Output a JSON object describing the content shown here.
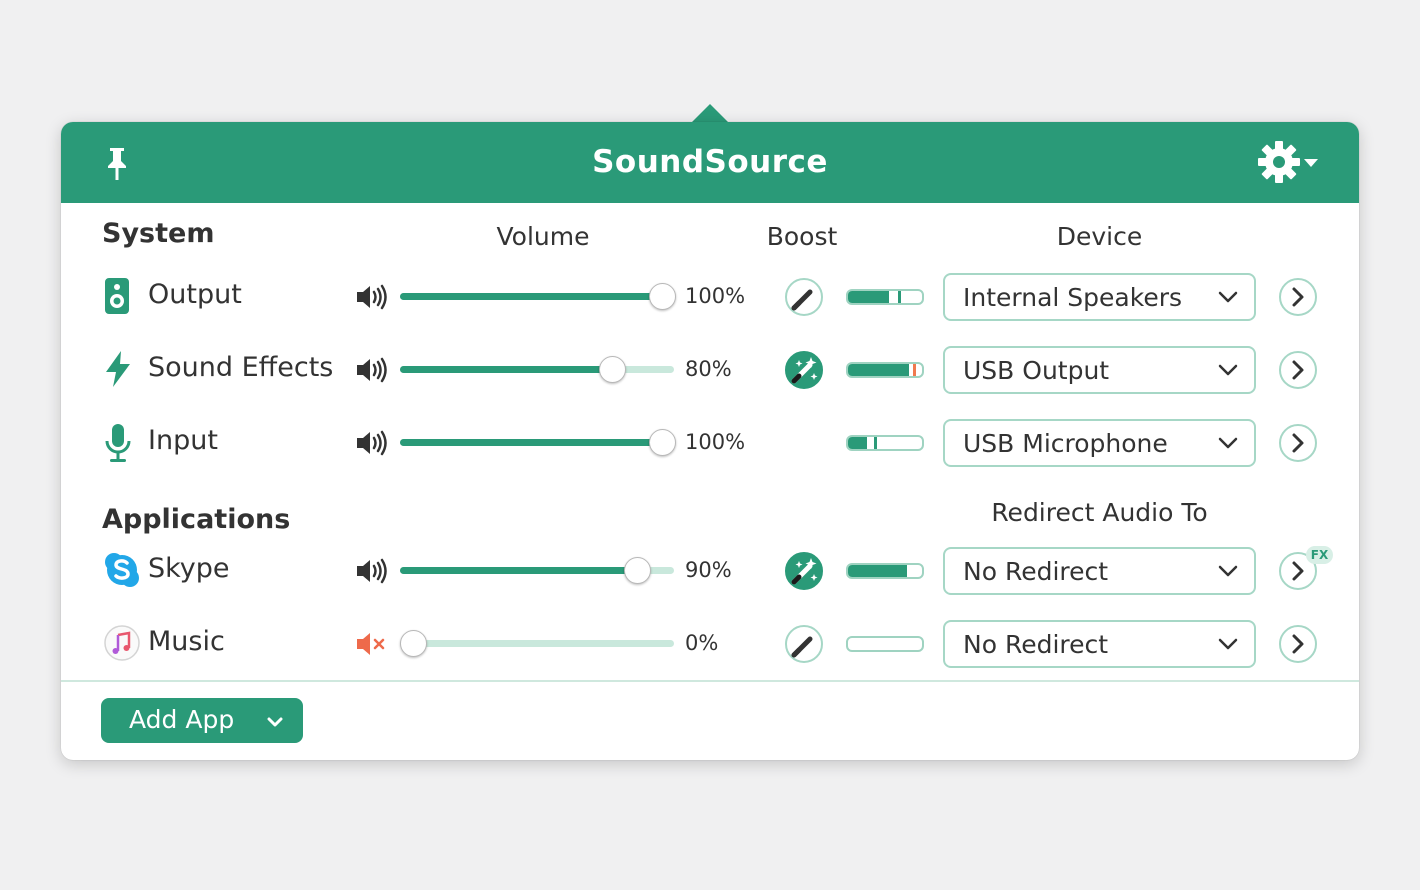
{
  "app": {
    "title": "SoundSource"
  },
  "colors": {
    "accent": "#2a9a78",
    "track": "#c9e8dc",
    "muted": "#ee6a4b",
    "peak": "#f07a4f"
  },
  "columns": {
    "volume": "Volume",
    "boost": "Boost",
    "device": "Device",
    "redirect": "Redirect Audio To"
  },
  "sections": {
    "system": "System",
    "applications": "Applications"
  },
  "system_rows": [
    {
      "label": "Output",
      "icon": "speaker-device-icon",
      "volume_text": "100%",
      "volume": 1.0,
      "boost_active": false,
      "meter_level": 0.55,
      "meter_peak": 0.68,
      "meter_peak_color": "#2a9a78",
      "device": "Internal Speakers",
      "muted": false
    },
    {
      "label": "Sound Effects",
      "icon": "lightning-icon",
      "volume_text": "80%",
      "volume": 0.8,
      "boost_active": true,
      "meter_level": 0.82,
      "meter_peak": 0.88,
      "meter_peak_color": "#f07a4f",
      "device": "USB Output",
      "muted": false
    },
    {
      "label": "Input",
      "icon": "microphone-icon",
      "volume_text": "100%",
      "volume": 1.0,
      "boost_active": null,
      "meter_level": 0.25,
      "meter_peak": 0.35,
      "meter_peak_color": "#2a9a78",
      "device": "USB Microphone",
      "muted": false
    }
  ],
  "app_rows": [
    {
      "label": "Skype",
      "icon": "skype-icon",
      "volume_text": "90%",
      "volume": 0.9,
      "boost_active": true,
      "meter_level": 0.8,
      "meter_peak": 0,
      "meter_peak_color": "#2a9a78",
      "device": "No Redirect",
      "muted": false,
      "fx": "FX"
    },
    {
      "label": "Music",
      "icon": "music-icon",
      "volume_text": "0%",
      "volume": 0.0,
      "boost_active": false,
      "meter_level": 0,
      "meter_peak": 0,
      "meter_peak_color": "#2a9a78",
      "device": "No Redirect",
      "muted": true
    }
  ],
  "footer": {
    "add_app_label": "Add App"
  }
}
